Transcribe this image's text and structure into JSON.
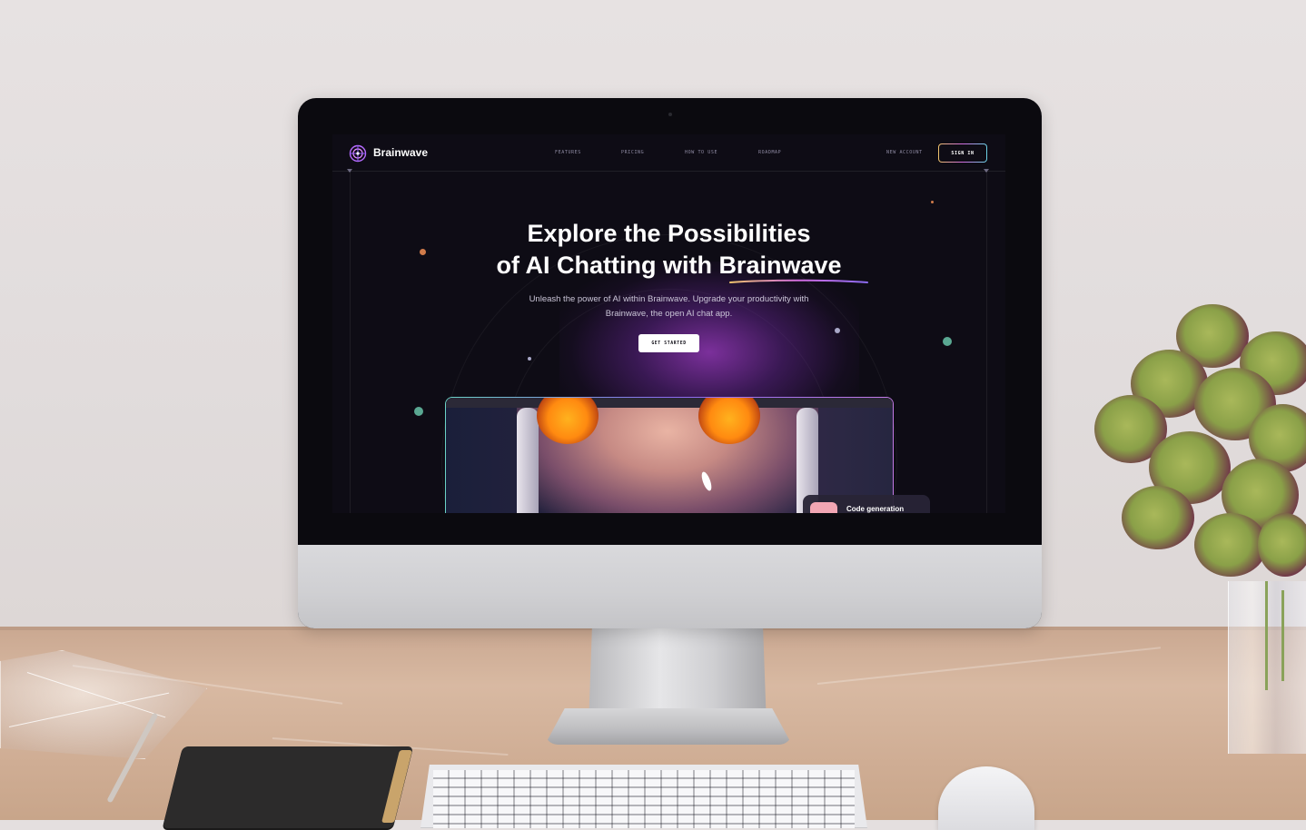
{
  "site": {
    "brand": "Brainwave",
    "nav": {
      "links": [
        "FEATURES",
        "PRICING",
        "HOW TO USE",
        "ROADMAP"
      ],
      "new_account": "NEW ACCOUNT",
      "sign_in": "SIGN IN"
    },
    "hero": {
      "title_line1": "Explore the Possibilities",
      "title_line2_prefix": "of AI Chatting with ",
      "title_highlight": "Brainwave",
      "subtitle_line1": "Unleash the power of AI within Brainwave. Upgrade your productivity with",
      "subtitle_line2": "Brainwave, the open AI chat app.",
      "cta": "GET STARTED"
    },
    "feature_card": {
      "label": "Code generation"
    }
  },
  "colors": {
    "background": "#0e0c15",
    "accent_purple": "#a03cc8",
    "gradient_gold": "#eec36b",
    "gradient_pink": "#d16be0",
    "gradient_cyan": "#6bd3e6",
    "text_muted": "#8f8ba3"
  },
  "icons": {
    "logo": "brain-logo-icon"
  }
}
